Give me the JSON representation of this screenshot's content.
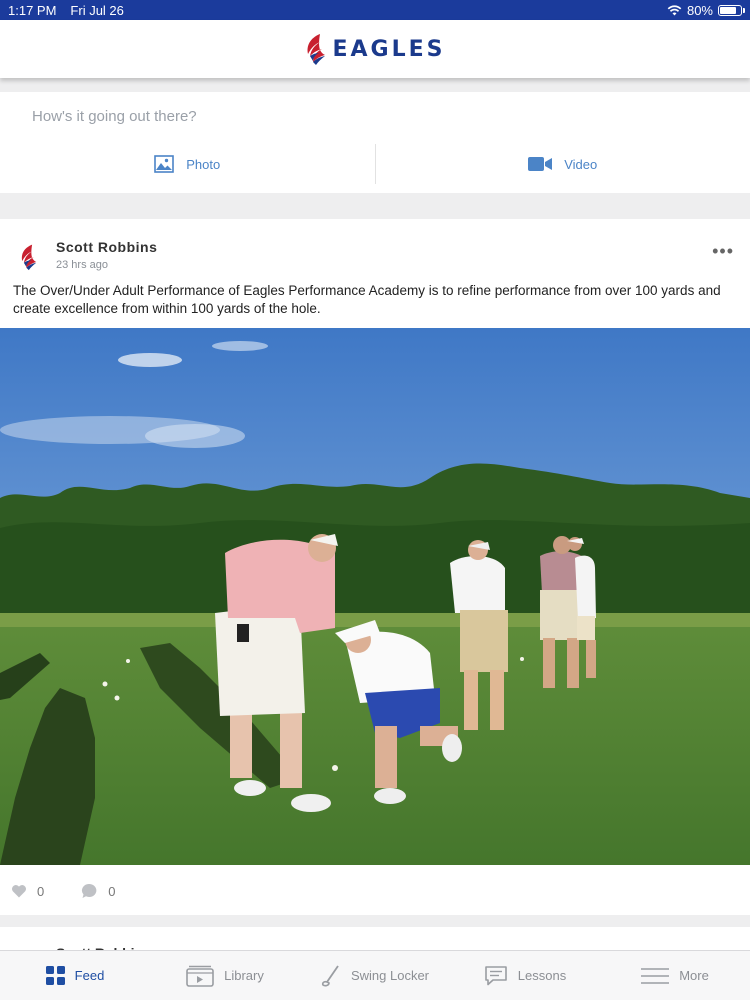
{
  "status_bar": {
    "time": "1:17 PM",
    "date": "Fri Jul 26",
    "battery": "80%",
    "battery_level": 0.8
  },
  "header": {
    "title": "EAGLES"
  },
  "composer": {
    "placeholder": "How's it going out there?",
    "photo_label": "Photo",
    "video_label": "Video"
  },
  "post": {
    "author": "Scott Robbins",
    "time": "23 hrs ago",
    "more": "•••",
    "text": "The Over/Under Adult Performance of Eagles Performance Academy is to refine performance from over 100 yards and create excellence from within 100 yards of the hole.",
    "likes": "0",
    "comments": "0"
  },
  "post2": {
    "author": "Scott Robbins"
  },
  "tabs": [
    {
      "label": "Feed",
      "icon": "feed-grid-icon",
      "active": true
    },
    {
      "label": "Library",
      "icon": "library-icon",
      "active": false
    },
    {
      "label": "Swing Locker",
      "icon": "golf-club-icon",
      "active": false
    },
    {
      "label": "Lessons",
      "icon": "chat-icon",
      "active": false
    },
    {
      "label": "More",
      "icon": "menu-icon",
      "active": false
    }
  ],
  "colors": {
    "brand": "#1b3a8c",
    "accent": "#4b84c7",
    "status_bar": "#1b3b9c",
    "logo_red": "#c8202f"
  }
}
